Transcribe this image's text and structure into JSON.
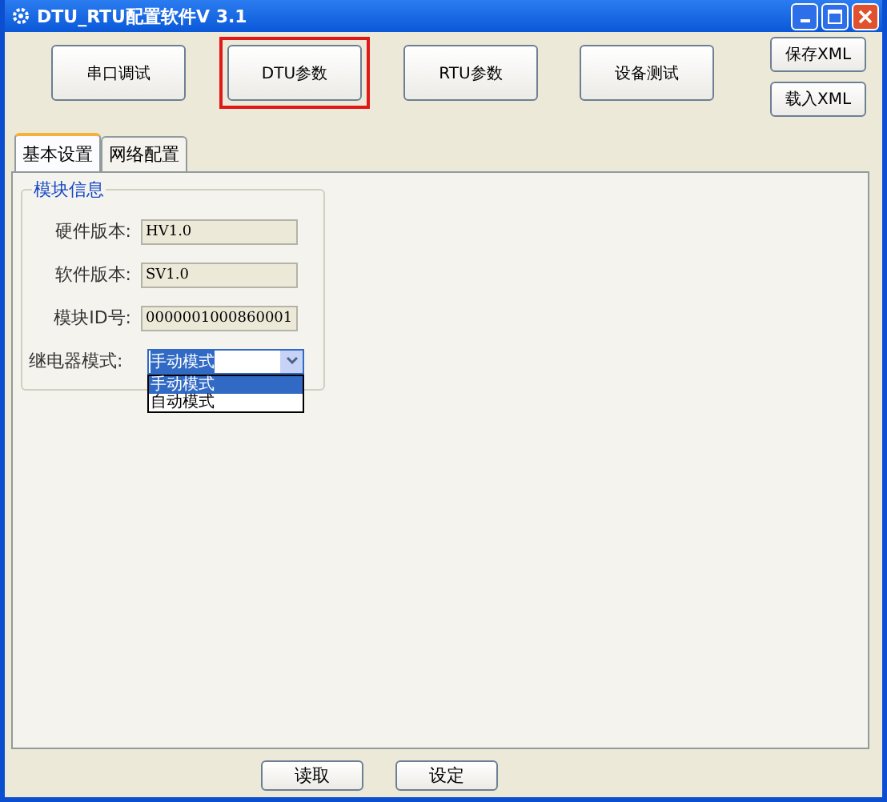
{
  "window": {
    "title": "DTU_RTU配置软件V 3.1"
  },
  "toolbar": [
    {
      "label": "串口调试",
      "highlighted": false
    },
    {
      "label": "DTU参数",
      "highlighted": true
    },
    {
      "label": "RTU参数",
      "highlighted": false
    },
    {
      "label": "设备测试",
      "highlighted": false
    }
  ],
  "xml_buttons": [
    "保存XML",
    "载入XML"
  ],
  "tabs": [
    {
      "label": "基本设置",
      "selected": true
    },
    {
      "label": "网络配置",
      "selected": false
    }
  ],
  "group": {
    "title": "模块信息",
    "fields": [
      {
        "label": "硬件版本:",
        "value": "HV1.0"
      },
      {
        "label": "软件版本:",
        "value": "SV1.0"
      },
      {
        "label": "模块ID号:",
        "value": "0000001000860001"
      }
    ]
  },
  "relay_mode": {
    "label": "继电器模式:",
    "value": "手动模式",
    "expanded": true,
    "options": [
      {
        "label": "手动模式",
        "selected": true
      },
      {
        "label": "自动模式",
        "selected": false
      }
    ]
  },
  "buttons": [
    "读取",
    "设定"
  ]
}
